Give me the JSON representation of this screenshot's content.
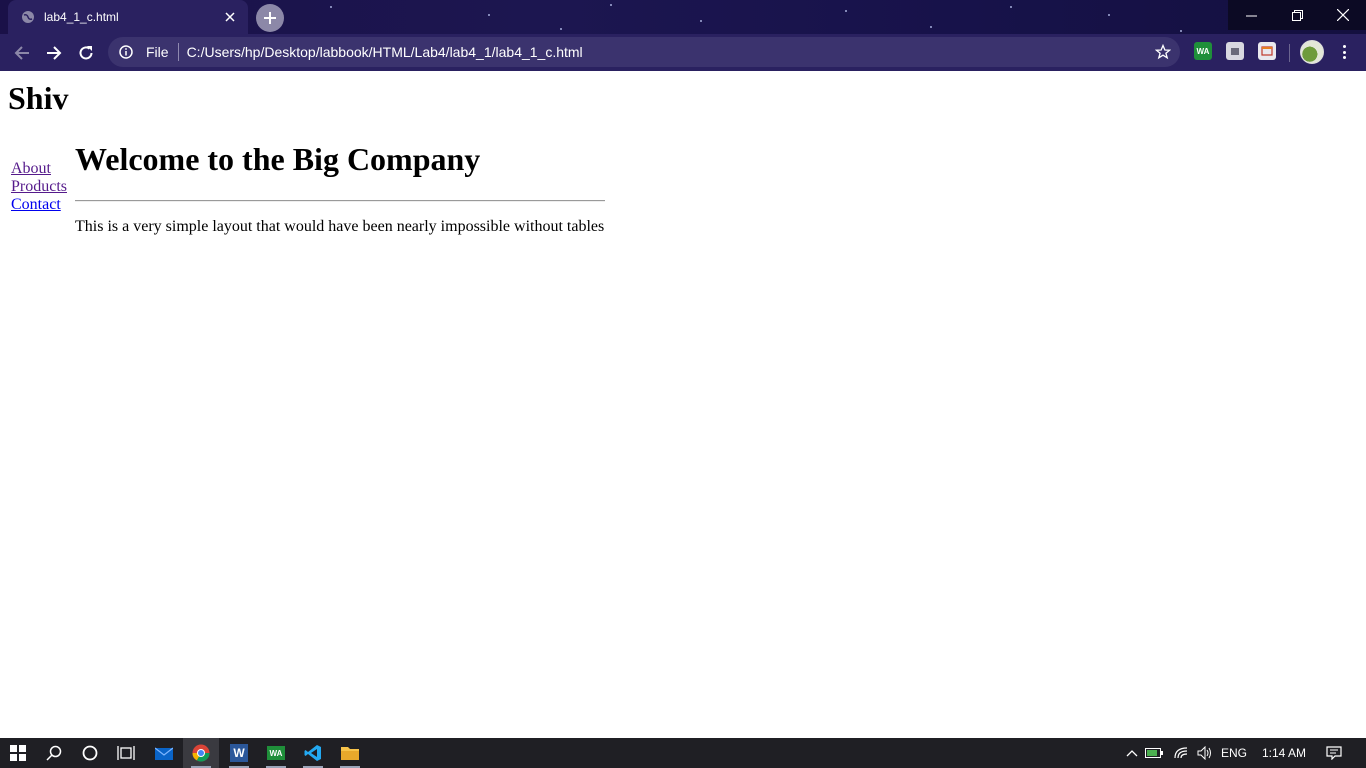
{
  "browser": {
    "tab_title": "lab4_1_c.html",
    "omnibox_scheme_label": "File",
    "url": "C:/Users/hp/Desktop/labbook/HTML/Lab4/lab4_1/lab4_1_c.html",
    "extension_badge": "WA"
  },
  "page": {
    "site_title": "Shiv",
    "nav": [
      {
        "label": "About"
      },
      {
        "label": "Products"
      },
      {
        "label": "Contact"
      }
    ],
    "heading": "Welcome to the Big Company",
    "paragraph": "This is a very simple layout that would have been nearly impossible without tables"
  },
  "taskbar": {
    "language": "ENG",
    "time": "1:14 AM",
    "word_label": "W",
    "wa_label": "WA"
  },
  "colors": {
    "link": "#0000ee",
    "visited_link": "#551a8b",
    "chrome_frame": "#2a2160"
  }
}
